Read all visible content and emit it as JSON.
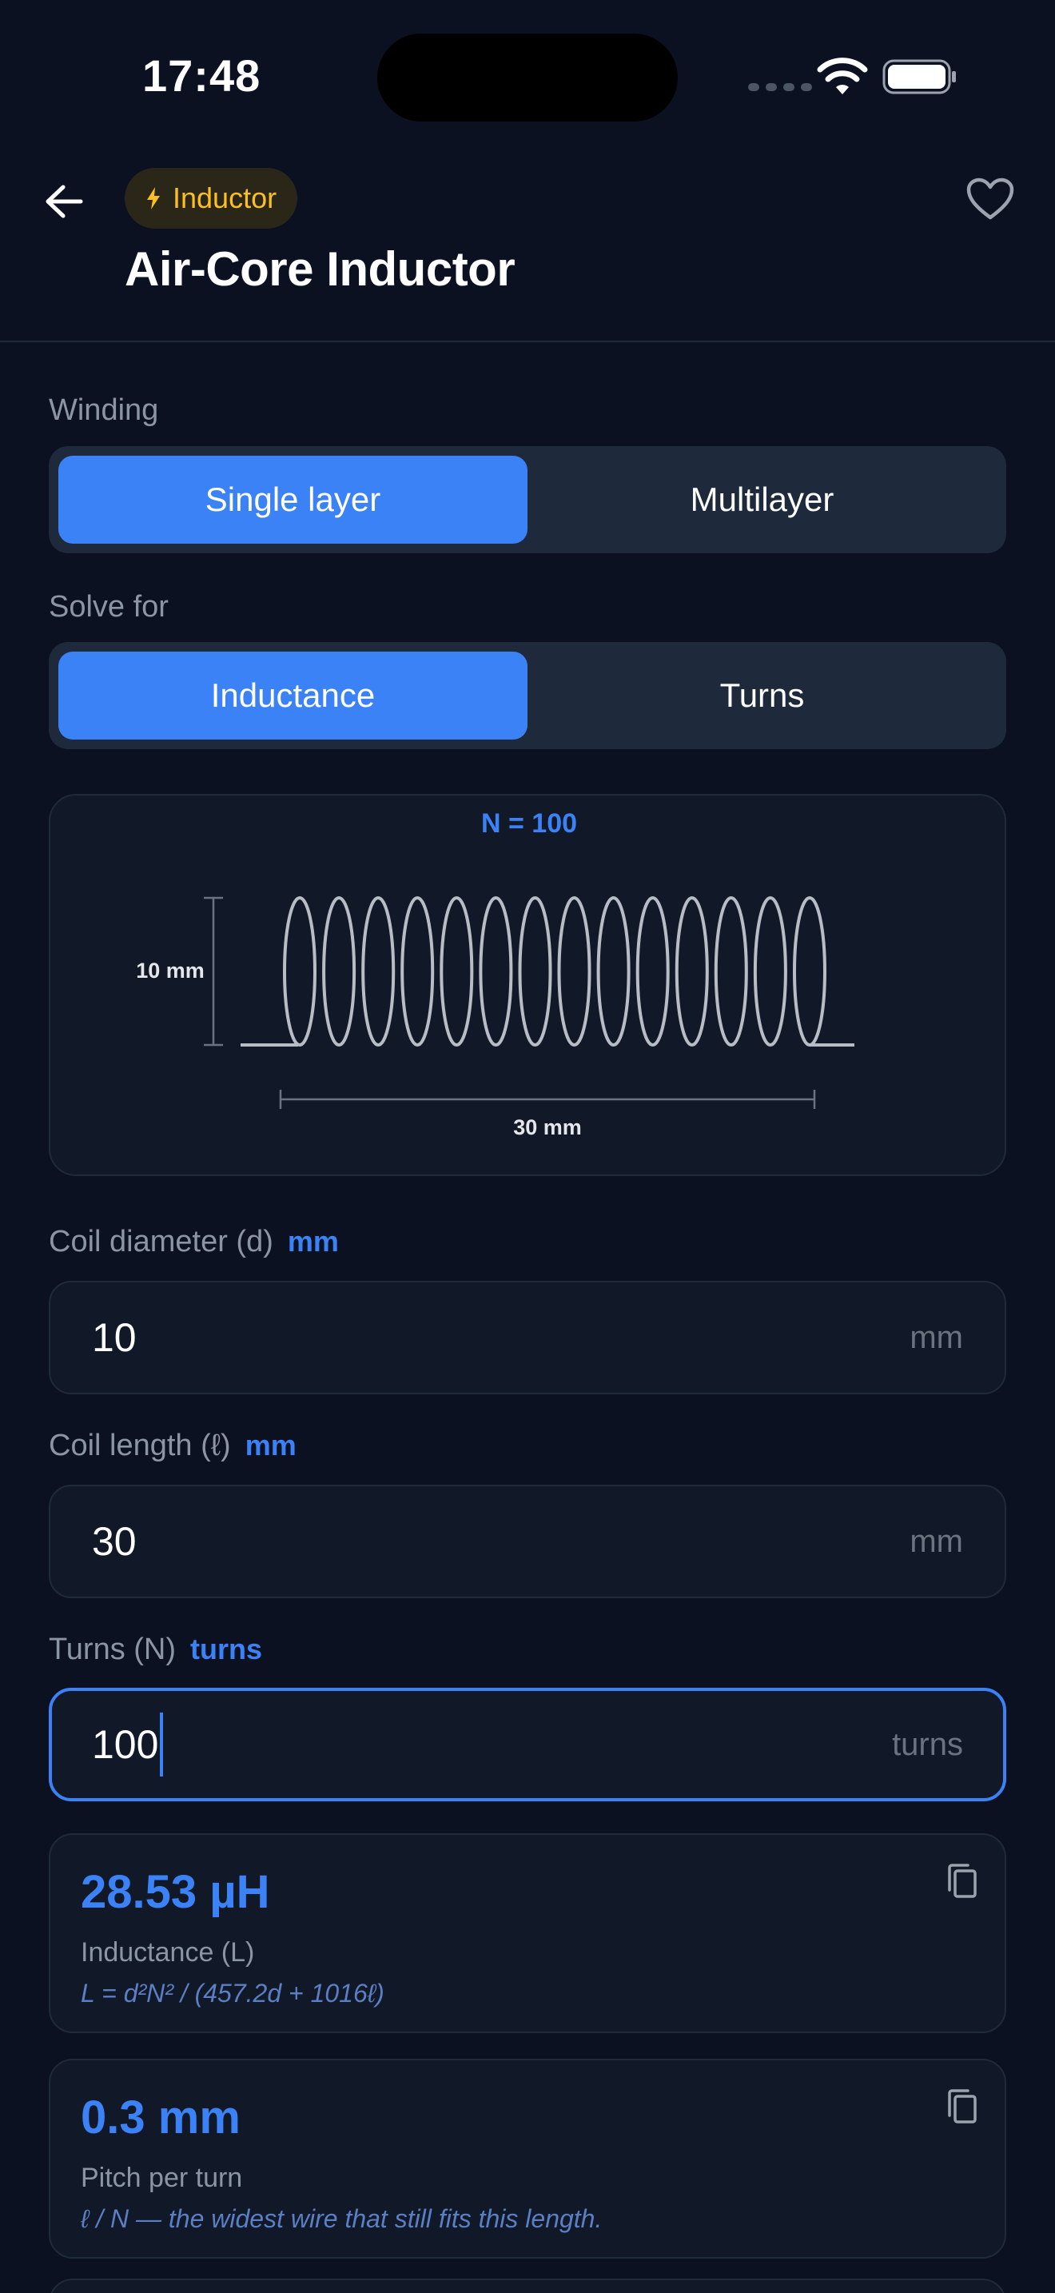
{
  "status_bar": {
    "time": "17:48"
  },
  "header": {
    "category_chip": "Inductor",
    "title": "Air-Core Inductor"
  },
  "winding": {
    "label": "Winding",
    "options": [
      "Single layer",
      "Multilayer"
    ],
    "selected": "Single layer"
  },
  "solve_for": {
    "label": "Solve for",
    "options": [
      "Inductance",
      "Turns"
    ],
    "selected": "Inductance"
  },
  "diagram": {
    "turns_label": "N = 100",
    "diameter_label": "10 mm",
    "length_label": "30 mm",
    "coil_loops_drawn": 14
  },
  "fields": {
    "diameter": {
      "label": "Coil diameter (d)",
      "unit_tag": "mm",
      "value": "10",
      "suffix": "mm"
    },
    "length": {
      "label": "Coil length (ℓ)",
      "unit_tag": "mm",
      "value": "30",
      "suffix": "mm"
    },
    "turns": {
      "label": "Turns (N)",
      "unit_tag": "turns",
      "value": "100",
      "suffix": "turns"
    }
  },
  "results": {
    "inductance": {
      "value": "28.53 µH",
      "label": "Inductance (L)",
      "formula": "L = d²N² / (457.2d + 1016ℓ)"
    },
    "pitch": {
      "value": "0.3 mm",
      "label": "Pitch per turn",
      "formula": "ℓ / N — the widest wire that still fits this length."
    }
  },
  "icons": {
    "back": "arrow-left-icon",
    "chip": "bolt-icon",
    "favorite": "heart-outline-icon",
    "copy": "copy-icon"
  },
  "colors": {
    "background": "#0b1120",
    "accent": "#3b82f6",
    "chip_text": "#fbbf24",
    "card": "#111827",
    "segment_track": "#1e293b"
  }
}
